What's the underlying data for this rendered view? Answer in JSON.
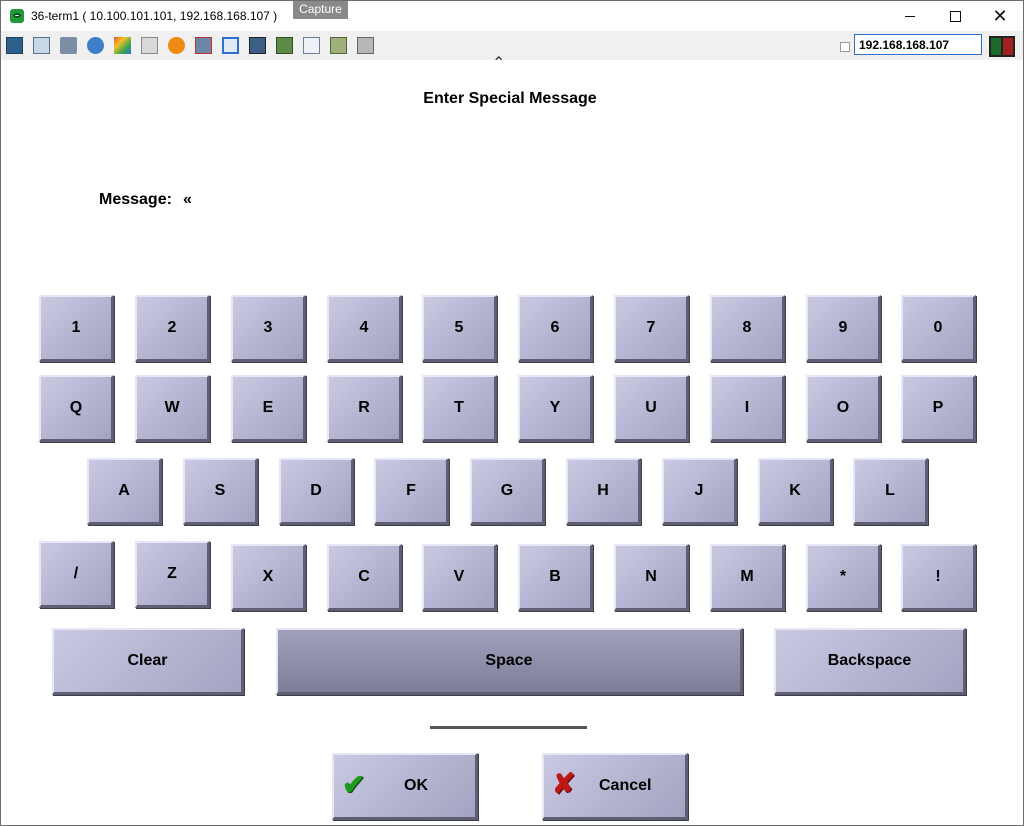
{
  "window": {
    "title": "36-term1 ( 10.100.101.101, 192.168.168.107 )",
    "capture_tag": "Capture",
    "minimize_icon": "minimize-icon",
    "maximize_icon": "maximize-icon",
    "close_icon": "close-icon"
  },
  "toolbar": {
    "icons": [
      "monitor-icon",
      "windows-icon",
      "tools-icon",
      "refresh-icon",
      "color-icon",
      "keyboard-icon",
      "alert-icon",
      "network-icon",
      "fullscreen-icon",
      "screen-icon",
      "transfer-icon",
      "document-icon",
      "fit-icon",
      "chat-icon"
    ],
    "ip_address": "192.168.168.107"
  },
  "dialog": {
    "title": "Enter Special Message",
    "message_label": "Message:",
    "message_value": "«"
  },
  "keyboard": {
    "row1": [
      "1",
      "2",
      "3",
      "4",
      "5",
      "6",
      "7",
      "8",
      "9",
      "0"
    ],
    "row2": [
      "Q",
      "W",
      "E",
      "R",
      "T",
      "Y",
      "U",
      "I",
      "O",
      "P"
    ],
    "row3": [
      "A",
      "S",
      "D",
      "F",
      "G",
      "H",
      "J",
      "K",
      "L"
    ],
    "row4": [
      "/",
      "Z",
      "X",
      "C",
      "V",
      "B",
      "N",
      "M",
      "*",
      "!"
    ],
    "clear": "Clear",
    "space": "Space",
    "backspace": "Backspace"
  },
  "actions": {
    "ok": "OK",
    "cancel": "Cancel"
  },
  "colors": {
    "key_face": "#b6b6d3",
    "space_face": "#8f8fab",
    "ok_check": "#1f9a1f",
    "cancel_x": "#c01818"
  }
}
